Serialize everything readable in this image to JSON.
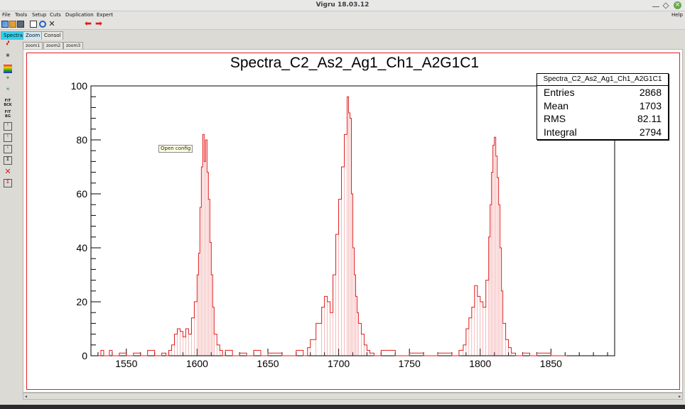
{
  "window": {
    "title": "Vigru 18.03.12"
  },
  "menubar": {
    "items": [
      "File",
      "Tools",
      "Setup",
      "Cuts",
      "Duplication",
      "Expert"
    ],
    "help": "Help"
  },
  "tabs": [
    "Spectra",
    "Zoom",
    "Consol"
  ],
  "subtabs": [
    "zoom1",
    "zoom2",
    "zoom3"
  ],
  "tooltip": "Open config",
  "stats": {
    "title": "Spectra_C2_As2_Ag1_Ch1_A2G1C1",
    "rows": [
      {
        "label": "Entries",
        "value": "2868"
      },
      {
        "label": "Mean",
        "value": "1703"
      },
      {
        "label": "RMS",
        "value": "82.11"
      },
      {
        "label": "Integral",
        "value": "2794"
      }
    ]
  },
  "chart_data": {
    "type": "line",
    "title": "Spectra_C2_As2_Ag1_Ch1_A2G1C1",
    "xlabel": "",
    "ylabel": "",
    "xlim": [
      1525,
      1895
    ],
    "ylim": [
      0,
      100
    ],
    "x_ticks": [
      1550,
      1600,
      1650,
      1700,
      1750,
      1800,
      1850
    ],
    "y_ticks": [
      0,
      20,
      40,
      60,
      80,
      100
    ],
    "grid": false,
    "series": [
      {
        "color": "#e01b1b",
        "x": [
          1530,
          1532,
          1534,
          1536,
          1538,
          1540,
          1542,
          1545,
          1550,
          1555,
          1560,
          1565,
          1570,
          1575,
          1578,
          1580,
          1582,
          1584,
          1586,
          1588,
          1590,
          1592,
          1594,
          1596,
          1598,
          1600,
          1601,
          1602,
          1603,
          1604,
          1605,
          1606,
          1607,
          1608,
          1609,
          1610,
          1611,
          1612,
          1614,
          1616,
          1618,
          1620,
          1625,
          1630,
          1635,
          1640,
          1645,
          1650,
          1660,
          1670,
          1675,
          1678,
          1680,
          1684,
          1688,
          1690,
          1692,
          1694,
          1696,
          1698,
          1700,
          1702,
          1704,
          1706,
          1707,
          1708,
          1709,
          1710,
          1711,
          1712,
          1713,
          1714,
          1716,
          1718,
          1720,
          1722,
          1725,
          1730,
          1740,
          1750,
          1760,
          1770,
          1780,
          1785,
          1788,
          1790,
          1792,
          1794,
          1796,
          1798,
          1800,
          1802,
          1804,
          1806,
          1807,
          1808,
          1809,
          1810,
          1811,
          1812,
          1813,
          1814,
          1815,
          1816,
          1818,
          1820,
          1822,
          1825,
          1830,
          1835,
          1840,
          1850,
          1860
        ],
        "y": [
          0,
          2,
          0,
          0,
          2,
          0,
          0,
          1,
          0,
          1,
          0,
          2,
          0,
          1,
          0,
          2,
          4,
          8,
          10,
          9,
          7,
          10,
          8,
          14,
          20,
          30,
          38,
          55,
          70,
          82,
          72,
          80,
          68,
          58,
          42,
          30,
          18,
          8,
          4,
          2,
          0,
          2,
          0,
          1,
          0,
          2,
          0,
          1,
          0,
          2,
          0,
          3,
          6,
          12,
          18,
          22,
          20,
          16,
          30,
          45,
          58,
          70,
          82,
          96,
          90,
          88,
          60,
          40,
          30,
          22,
          16,
          12,
          8,
          4,
          2,
          1,
          0,
          2,
          0,
          1,
          0,
          1,
          0,
          2,
          4,
          10,
          14,
          18,
          26,
          22,
          20,
          18,
          28,
          44,
          56,
          68,
          78,
          81,
          74,
          66,
          56,
          40,
          24,
          12,
          6,
          3,
          1,
          0,
          1,
          0,
          1,
          0,
          0
        ]
      }
    ]
  }
}
